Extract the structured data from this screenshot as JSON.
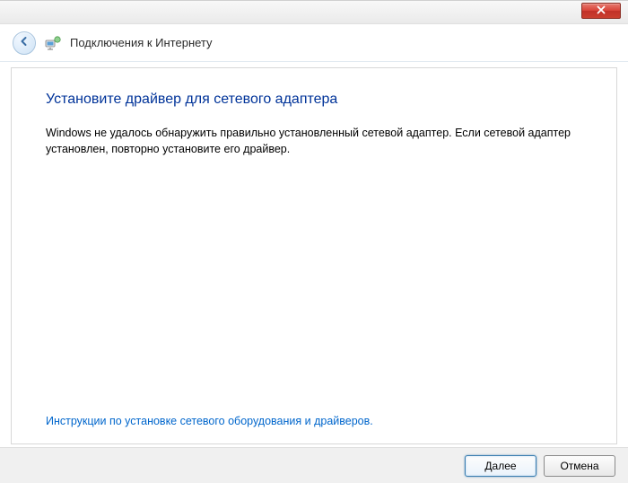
{
  "header": {
    "title": "Подключения к Интернету"
  },
  "content": {
    "heading": "Установите драйвер для сетевого адаптера",
    "body": "Windows не удалось обнаружить правильно установленный сетевой адаптер. Если сетевой адаптер установлен, повторно установите его драйвер.",
    "link": "Инструкции по установке сетевого оборудования и драйверов."
  },
  "footer": {
    "next": "Далее",
    "cancel": "Отмена"
  },
  "icons": {
    "close": "close-icon",
    "back": "back-arrow-icon",
    "wizard": "network-wizard-icon"
  }
}
